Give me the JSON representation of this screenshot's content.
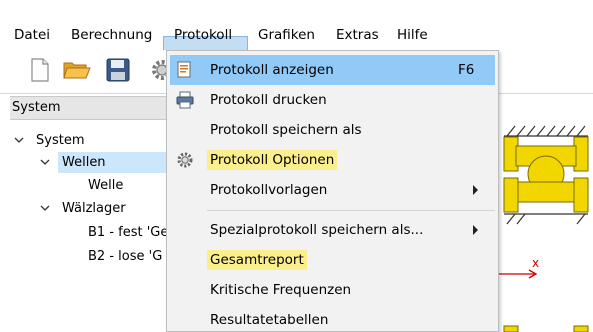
{
  "menubar": {
    "items": [
      "Datei",
      "Berechnung",
      "Protokoll",
      "Grafiken",
      "Extras",
      "Hilfe"
    ],
    "active_index": 2
  },
  "toolbar": {
    "buttons": [
      "new-document-icon",
      "open-folder-icon",
      "save-disk-icon",
      "settings-gear-icon"
    ]
  },
  "panel": {
    "title": "System",
    "tree": [
      {
        "label": "System",
        "level": 0,
        "expanded": true
      },
      {
        "label": "Wellen",
        "level": 1,
        "expanded": true,
        "selected": true
      },
      {
        "label": "Welle",
        "level": 2
      },
      {
        "label": "Wälzlager",
        "level": 1,
        "expanded": true
      },
      {
        "label": "B1 - fest 'Ge",
        "level": 2
      },
      {
        "label": "B2 - lose 'G",
        "level": 2
      }
    ]
  },
  "dropdown": {
    "items": [
      {
        "label": "Protokoll anzeigen",
        "shortcut": "F6",
        "icon": "report-view-icon",
        "hovered": true
      },
      {
        "label": "Protokoll drucken",
        "icon": "printer-icon"
      },
      {
        "label": "Protokoll speichern als"
      },
      {
        "label": "Protokoll Optionen",
        "icon": "gear-icon",
        "highlighted": true
      },
      {
        "label": "Protokollvorlagen",
        "submenu": true
      },
      {
        "label": "Spezialprotokoll speichern als...",
        "submenu": true
      },
      {
        "label": "Gesamtreport",
        "highlighted": true
      },
      {
        "label": "Kritische Frequenzen"
      },
      {
        "label": "Resultatetabellen"
      }
    ]
  },
  "drawing": {
    "axis_label": "x",
    "accent_color": "#f2d600",
    "axis_color": "#cc0000"
  }
}
